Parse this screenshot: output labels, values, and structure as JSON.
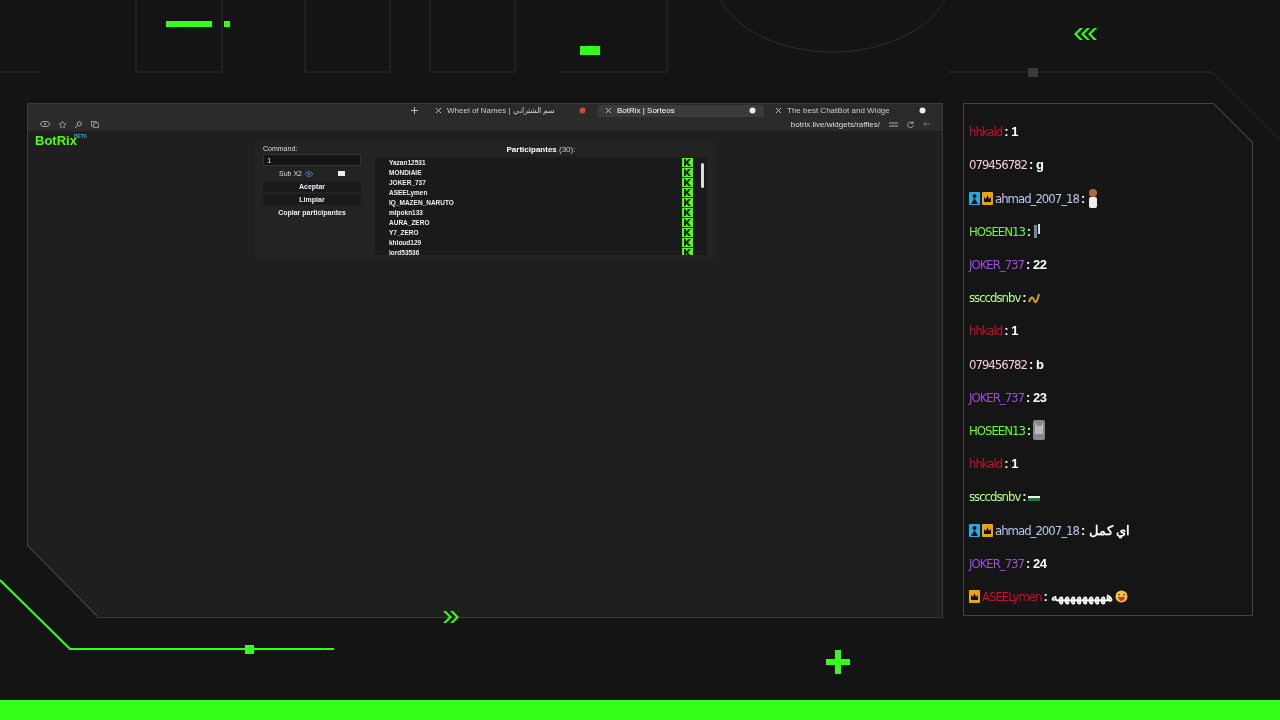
{
  "browser": {
    "tabs": [
      {
        "label": "Wheel of Names | سم الشتراني",
        "selected": false
      },
      {
        "label": "BotRix | Sorteos",
        "selected": true
      },
      {
        "label": "The best ChatBot and Widge",
        "selected": false
      }
    ],
    "url": "botrix.live/widgets/raffles/"
  },
  "app": {
    "logo": "BotRix",
    "logo_badge": "BETA",
    "command": {
      "label": "Command:",
      "value": "1"
    },
    "sub_option": {
      "label": "Sub X2",
      "checked": false
    },
    "buttons": [
      "Aceptar",
      "Limpiar",
      "Copiar participantes"
    ],
    "participants": {
      "title": "Participantes",
      "count": "(30):",
      "names": [
        "Yazan12531",
        "MONDIAIE",
        "JOKER_737",
        "ASEELymen",
        "IQ_MAZEN_NARUTO",
        "mlpokn133",
        "AURA_ZERO",
        "Y7_ZERO",
        "khloud129",
        "lord53536"
      ]
    }
  },
  "chat": [
    {
      "user": "hhkald",
      "color": "#c8102e",
      "text": ": 1"
    },
    {
      "user": "079456782",
      "color": "#f2d0dc",
      "text": ": g"
    },
    {
      "user": "ahmad_2007_18",
      "color": "#b9c8e8",
      "badges": [
        {
          "kind": "person"
        },
        {
          "kind": "crown"
        }
      ],
      "text": ":",
      "emote": {
        "kind": "figure"
      }
    },
    {
      "user": "HOSEEN13",
      "color": "#66ff33",
      "text": ":",
      "emote": {
        "kind": "bottle"
      }
    },
    {
      "user": "JOKER_737",
      "color": "#9b4de0",
      "text": ": 22"
    },
    {
      "user": "ssccdsnbv",
      "color": "#b8ff8a",
      "text": ":",
      "emote": {
        "kind": "squiggle"
      }
    },
    {
      "user": "hhkald",
      "color": "#c8102e",
      "text": ": 1"
    },
    {
      "user": "079456782",
      "color": "#f2d0dc",
      "text": ": b"
    },
    {
      "user": "JOKER_737",
      "color": "#9b4de0",
      "text": ": 23"
    },
    {
      "user": "HOSEEN13",
      "color": "#66ff33",
      "text": ":",
      "emote": {
        "kind": "cat"
      }
    },
    {
      "user": "hhkald",
      "color": "#c8102e",
      "text": ": 1"
    },
    {
      "user": "ssccdsnbv",
      "color": "#b8ff8a",
      "text": ":",
      "emote": {
        "kind": "flag"
      }
    },
    {
      "user": "ahmad_2007_18",
      "color": "#b9c8e8",
      "badges": [
        {
          "kind": "person"
        },
        {
          "kind": "crown"
        }
      ],
      "text": ": اي كمل"
    },
    {
      "user": "JOKER_737",
      "color": "#9b4de0",
      "text": ": 24"
    },
    {
      "user": "ASEELymen",
      "color": "#c8102e",
      "badges": [
        {
          "kind": "crown"
        }
      ],
      "text": ": هههههههههه",
      "emote": {
        "kind": "laugh"
      }
    }
  ]
}
